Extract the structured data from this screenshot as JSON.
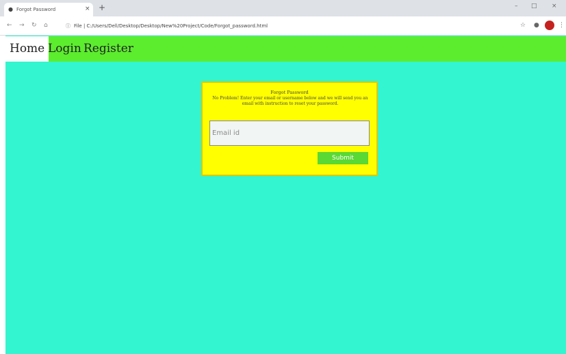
{
  "browser": {
    "tab_title": "Forgot Password",
    "tab_favicon": "globe-icon",
    "url": "File | C:/Users/Dell/Desktop/Desktop/New%20Project/Code/Forgot_password.html"
  },
  "navbar": {
    "items": [
      {
        "label": "Home",
        "active": true
      },
      {
        "label": "Login",
        "active": false
      },
      {
        "label": "Register",
        "active": false
      }
    ]
  },
  "form": {
    "title": "Forgot Password",
    "message": "No Problem! Enter your email or username below and we will send you an email with instruction to reset your password.",
    "email_placeholder": "Email id",
    "submit_label": "Submit"
  },
  "colors": {
    "page_background": "#33f5cf",
    "navbar": "#5ced2e",
    "card": "#ffff00",
    "button": "#5ad834"
  }
}
